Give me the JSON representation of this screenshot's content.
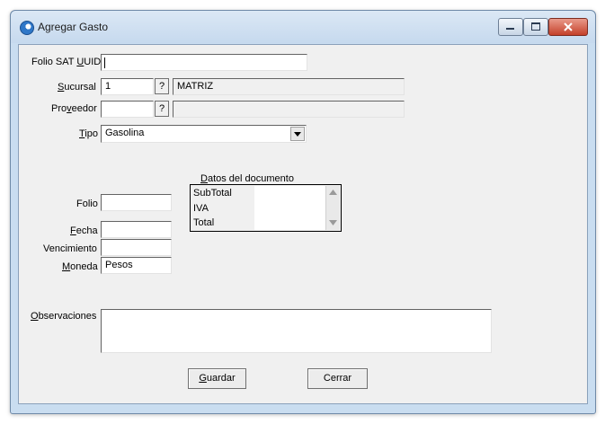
{
  "window": {
    "title": "Agregar Gasto",
    "controls": {
      "minimize": "minimize-icon",
      "maximize": "maximize-icon",
      "close": "close-icon"
    }
  },
  "form": {
    "folio_sat": {
      "label_pre": "Folio SAT ",
      "label_key": "U",
      "label_post": "UID",
      "value": ""
    },
    "sucursal": {
      "label_key": "S",
      "label_post": "ucursal",
      "value": "1",
      "lookup": "?",
      "name": "MATRIZ"
    },
    "proveedor": {
      "label_pre": "Pro",
      "label_key": "v",
      "label_post": "eedor",
      "value": "",
      "lookup": "?",
      "name": ""
    },
    "tipo": {
      "label_key": "T",
      "label_post": "ipo",
      "selected": "Gasolina"
    },
    "folio": {
      "label": "Folio",
      "value": ""
    },
    "fecha": {
      "label_key": "F",
      "label_post": "echa",
      "value": ""
    },
    "vencimiento": {
      "label": "Vencimiento",
      "value": ""
    },
    "moneda": {
      "label_key": "M",
      "label_post": "oneda",
      "value": "Pesos"
    },
    "observaciones": {
      "label_key": "O",
      "label_post": "bservaciones",
      "value": ""
    }
  },
  "documento": {
    "label_key": "D",
    "label_post": "atos del documento",
    "rows": [
      {
        "name": "SubTotal",
        "value": ""
      },
      {
        "name": "IVA",
        "value": ""
      },
      {
        "name": "Total",
        "value": ""
      }
    ]
  },
  "buttons": {
    "guardar": {
      "key": "G",
      "rest": "uardar"
    },
    "cerrar": "Cerrar"
  }
}
